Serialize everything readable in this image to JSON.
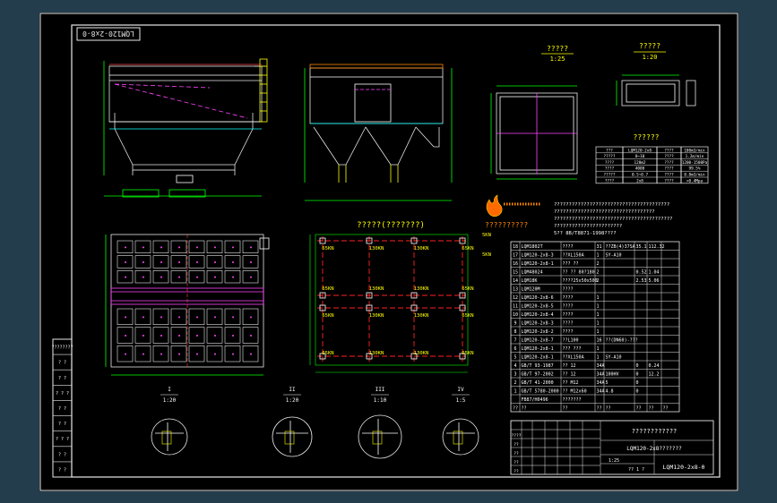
{
  "drawing": {
    "stamp_code": "LQM120-2x8-0",
    "sections": {
      "front_view_title": "?????",
      "front_view_scale": "1:25",
      "detail_top_title": "?????",
      "detail_top_scale": "1:20",
      "table_title": "??????",
      "notes_title": "????",
      "plan_title": "?????(???????)",
      "flame_label": "??????????"
    },
    "notes_lines": [
      "???????????????????????????????????????",
      "??????????????????????????????????",
      "????????????????????????????????????????",
      "???????????????????????",
      "5?? 8B/T8871-1998????"
    ],
    "spec_table": [
      [
        "???",
        "LQM120-2x8",
        "????",
        "100m3/min"
      ],
      [
        "?????",
        "8~10",
        "????",
        "1.2m/min"
      ],
      [
        "????",
        "120m2",
        "????",
        "1200-1500Pa"
      ],
      [
        "????",
        "4000",
        "????",
        "99.5%"
      ],
      [
        "?????",
        "0.5~0.7",
        "????",
        "0.8m3/min"
      ],
      [
        "????",
        "2x8",
        "????",
        ">0.4Mpa"
      ]
    ],
    "plan_labels": {
      "kn_left_top": "65KN",
      "kn_left_bottom": "65KN",
      "kn_right_top": "65KN",
      "kn_right_bottom": "65KN",
      "kn_mid_top": "130KN",
      "kn_mid_a": "130KN",
      "kn_mid_b": "130KN",
      "kn_mid_c": "130KN",
      "kn_side_left": "65KN",
      "kn_side_right": "65KN",
      "kn_center": "130KN",
      "kn_center2": "130KN",
      "side_top": "5KN",
      "side_mid": "5KN"
    },
    "section_markers": [
      {
        "letter": "I",
        "scale": "1:20"
      },
      {
        "letter": "II",
        "scale": "1:20"
      },
      {
        "letter": "III",
        "scale": "1:10"
      },
      {
        "letter": "IV",
        "scale": "1:5"
      }
    ],
    "bom_rows": [
      [
        "18",
        "LQM1802T",
        "????",
        "31",
        "??ZB(4)37SA",
        "35.1",
        "112.32",
        ""
      ],
      [
        "17",
        "LQM120-2x8-3",
        "??XL150A",
        "1",
        "SY-A10",
        "",
        "",
        ""
      ],
      [
        "16",
        "LQM120-2x8-1",
        "??? ??",
        "2",
        "",
        "",
        "",
        ""
      ],
      [
        "15",
        "LQM48024",
        "?? ?? 80?180",
        "2",
        "",
        "0.52",
        "1.04",
        ""
      ],
      [
        "14",
        "LQM18K",
        "????25x50x500",
        "2",
        "",
        "2.53",
        "5.06",
        ""
      ],
      [
        "13",
        "LQM120M",
        "????",
        "",
        "",
        "",
        "",
        ""
      ],
      [
        "12",
        "LQM120-2x8-6",
        "????",
        "1",
        "",
        "",
        "",
        ""
      ],
      [
        "11",
        "LQM120-2x8-5",
        "????",
        "1",
        "",
        "",
        "",
        ""
      ],
      [
        "10",
        "LQM120-2x8-4",
        "????",
        "1",
        "",
        "",
        "",
        ""
      ],
      [
        "9",
        "LQM120-2x8-3",
        "????",
        "1",
        "",
        "",
        "",
        ""
      ],
      [
        "8",
        "LQM120-2x8-2",
        "????",
        "1",
        "",
        "",
        "",
        ""
      ],
      [
        "7",
        "LQM120-2x8-7",
        "??L100",
        "16",
        "??(DN60)-???",
        "",
        "",
        ""
      ],
      [
        "6",
        "LQM120-2x8-1",
        "??? ???",
        "1",
        "",
        "",
        "",
        ""
      ],
      [
        "5",
        "LQM120-2x8-1",
        "??XL150A",
        "1",
        "SY-A10",
        "",
        "",
        ""
      ],
      [
        "4",
        "GB/T 93-1987",
        "?? 12",
        "34A",
        "",
        "0",
        "0.24",
        ""
      ],
      [
        "3",
        "GB/T 97-2002",
        "?? 12",
        "34A",
        "100HV",
        "0",
        "12.2",
        ""
      ],
      [
        "2",
        "GB/T 41-2000",
        "?? M12",
        "34A",
        "5",
        "0",
        "",
        ""
      ],
      [
        "1",
        "GB/T 5780-2000",
        "?? M12x60",
        "34A",
        "4.8",
        "0",
        "",
        ""
      ],
      [
        "",
        "FB87/H0496",
        "???????",
        "",
        "",
        "",
        "",
        ""
      ],
      [
        "??",
        "??",
        "??",
        "??",
        "??",
        "??",
        "??",
        "??"
      ]
    ],
    "title_block": {
      "company": "????????????",
      "drawing_name": "LQM120-2x8???????",
      "drawing_no": "LQM120-2x8-0",
      "ratio": "1:25",
      "weight": "",
      "sheet": "?? 1 ?",
      "row1": "????",
      "row2": "??",
      "row3": "??",
      "row4": "??",
      "row5": "??"
    },
    "left_stamp": [
      "????????",
      "? ?",
      "? ?",
      "? ? ?",
      "? ?",
      "? ?",
      "? ? ?",
      "? ?",
      "? ?"
    ]
  }
}
